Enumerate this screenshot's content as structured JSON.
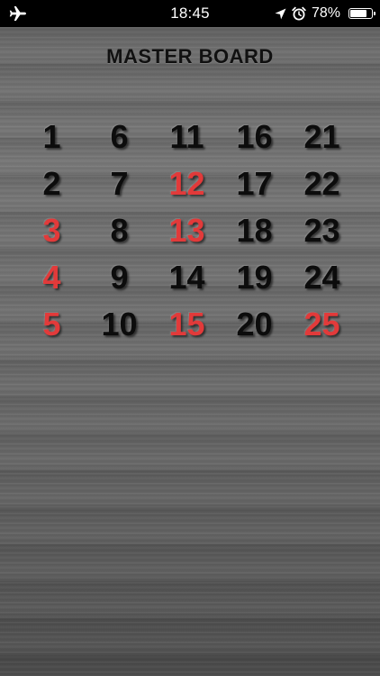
{
  "status_bar": {
    "time": "18:45",
    "battery": "78%",
    "battery_level": 0.78,
    "icons": [
      "airplane-icon",
      "location-arrow-icon",
      "alarm-icon",
      "battery-icon"
    ]
  },
  "board": {
    "title": "MASTER BOARD",
    "colors": {
      "called": "#e23a3a",
      "uncalled": "#0c0c0c"
    },
    "numbers": [
      {
        "value": "1",
        "called": false
      },
      {
        "value": "2",
        "called": false
      },
      {
        "value": "3",
        "called": true
      },
      {
        "value": "4",
        "called": true
      },
      {
        "value": "5",
        "called": true
      },
      {
        "value": "6",
        "called": false
      },
      {
        "value": "7",
        "called": false
      },
      {
        "value": "8",
        "called": false
      },
      {
        "value": "9",
        "called": false
      },
      {
        "value": "10",
        "called": false
      },
      {
        "value": "11",
        "called": false
      },
      {
        "value": "12",
        "called": true
      },
      {
        "value": "13",
        "called": true
      },
      {
        "value": "14",
        "called": false
      },
      {
        "value": "15",
        "called": true
      },
      {
        "value": "16",
        "called": false
      },
      {
        "value": "17",
        "called": false
      },
      {
        "value": "18",
        "called": false
      },
      {
        "value": "19",
        "called": false
      },
      {
        "value": "20",
        "called": false
      },
      {
        "value": "21",
        "called": false
      },
      {
        "value": "22",
        "called": false
      },
      {
        "value": "23",
        "called": false
      },
      {
        "value": "24",
        "called": false
      },
      {
        "value": "25",
        "called": true
      }
    ]
  }
}
